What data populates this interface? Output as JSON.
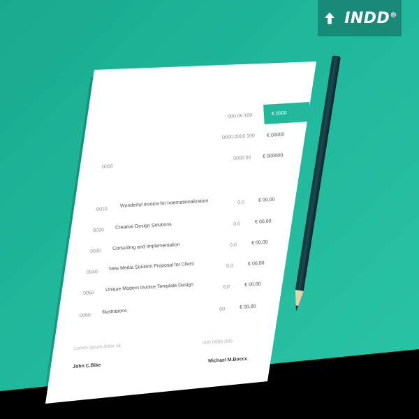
{
  "badge": {
    "label": "INDD",
    "mark": "®",
    "icon": "arrow-up-icon",
    "color": "#198a78"
  },
  "colors": {
    "background": "#22b89c",
    "paper": "#ffffff",
    "accent": "#22b89c"
  },
  "invoice": {
    "totals": [
      {
        "label": "000.00 100",
        "value": "€ 0000",
        "highlighted": true
      },
      {
        "label": "0000.0000 100",
        "value": "€ 00000",
        "highlighted": false
      },
      {
        "label": "0000 00",
        "value": "€ 000000",
        "highlighted": false
      }
    ],
    "section_label": "0000",
    "items": [
      {
        "no": "0010",
        "desc": "Wonderful invoice for Internationalization",
        "qty": "0,0",
        "price": "€ 00,00"
      },
      {
        "no": "0020",
        "desc": "Creative Design Solutions",
        "qty": "0,0",
        "price": "€ 00,00"
      },
      {
        "no": "0030",
        "desc": "Consulting and Implementation",
        "qty": "0,0",
        "price": "€ 00,00"
      },
      {
        "no": "0040",
        "desc": "New Media Solution Proposal for Client",
        "qty": "0,0",
        "price": "€ 00,00"
      },
      {
        "no": "0050",
        "desc": "Unique Modern Invoice Template Design",
        "qty": "0,0",
        "price": "€ 00,00"
      },
      {
        "no": "0060",
        "desc": "Illustrations",
        "qty": "00",
        "price": "€ 00,00"
      }
    ],
    "footer_left_small": "Lorem ipsum dolor sit",
    "footer_left_name": "John C.Bike",
    "footer_right_small": "000 0000 000",
    "footer_right_name": "Michael M.Boccc"
  }
}
